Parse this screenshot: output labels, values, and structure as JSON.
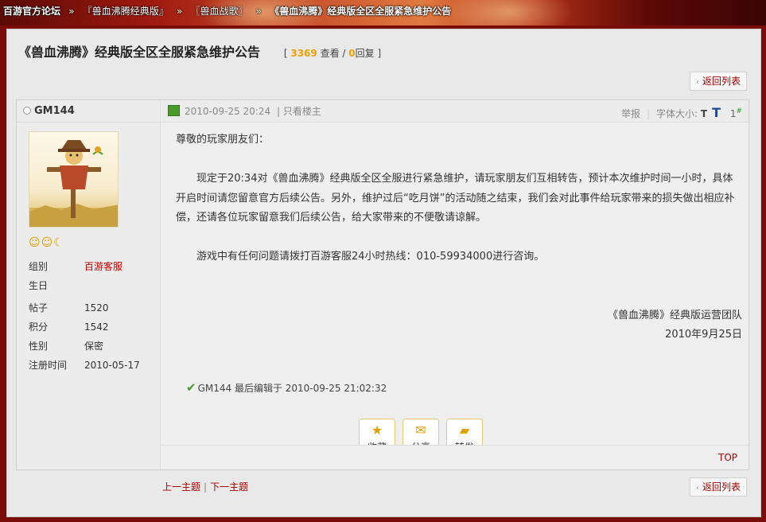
{
  "breadcrumb": {
    "home": "百游官方论坛",
    "items": [
      "『兽血沸腾经典版』",
      "〖兽血战歌〗"
    ],
    "current": "《兽血沸腾》经典版全区全服紧急维护公告"
  },
  "thread": {
    "title": "《兽血沸腾》经典版全区全服紧急维护公告",
    "views": "3369",
    "views_label": "查看",
    "replies": "0",
    "replies_label": "回复",
    "back_label": "返回列表"
  },
  "author": {
    "name": "GM144",
    "fields": [
      {
        "k": "组别",
        "v": "百游客服"
      },
      {
        "k": "生日",
        "v": ""
      },
      {
        "k": "帖子",
        "v": "1520"
      },
      {
        "k": "积分",
        "v": "1542"
      },
      {
        "k": "性别",
        "v": "保密"
      },
      {
        "k": "注册时间",
        "v": "2010-05-17"
      }
    ]
  },
  "post": {
    "date": "2010-09-25 20:24",
    "only_author": "只看楼主",
    "report": "举报",
    "font_size": "字体大小:",
    "font_small": "T",
    "font_large": "T",
    "floor": "1",
    "floor_mark": "#",
    "greeting": "尊敬的玩家朋友们：",
    "para1": "现定于20:34对《兽血沸腾》经典版全区全服进行紧急维护，请玩家朋友们互相转告，预计本次维护时间一小时，具体开启时间请您留意官方后续公告。另外，维护过后“吃月饼”的活动随之结束，我们会对此事件给玩家带来的损失做出相应补偿，还请各位玩家留意我们后续公告，给大家带来的不便敬请谅解。",
    "para2": "游戏中有任何问题请拨打百游客服24小时热线：010-59934000进行咨询。",
    "sign_team": "《兽血沸腾》经典版运营团队",
    "sign_date": "2010年9月25日",
    "edited": "GM144 最后编辑于 2010-09-25 21:02:32",
    "actions": [
      "收藏",
      "分享",
      "转发"
    ],
    "top": "TOP"
  },
  "nav": {
    "prev": "上一主题",
    "next": "下一主题"
  },
  "colors": {
    "accent": "#aa0000",
    "stat": "#f0a000"
  }
}
